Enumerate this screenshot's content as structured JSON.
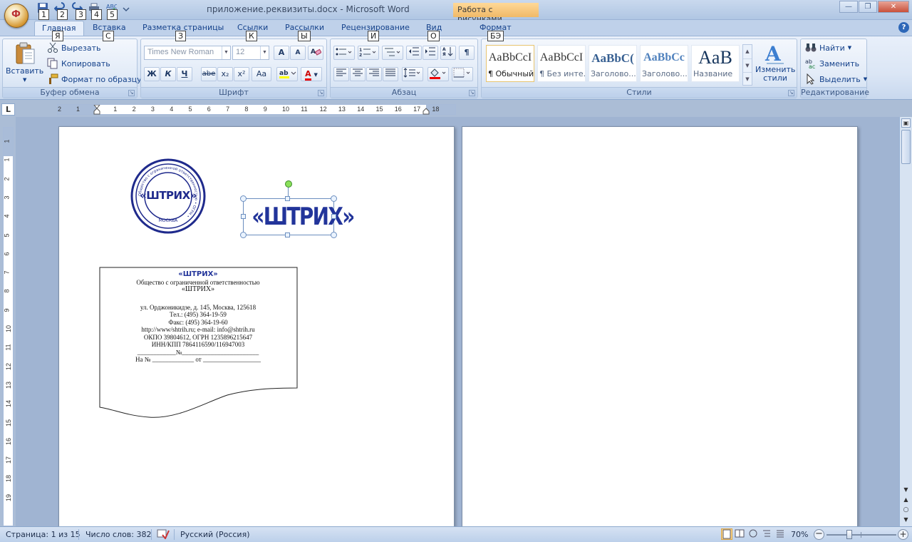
{
  "window": {
    "title": "приложение.реквизиты.docx - Microsoft Word",
    "context_tab": "Работа с рисунками",
    "office_button_glyph": "Ф"
  },
  "qat": {
    "keytips": [
      "1",
      "2",
      "3",
      "4",
      "5"
    ]
  },
  "tabs": [
    {
      "label": "Главная",
      "keytip": "Я"
    },
    {
      "label": "Вставка",
      "keytip": "С"
    },
    {
      "label": "Разметка страницы",
      "keytip": "З"
    },
    {
      "label": "Ссылки",
      "keytip": "К"
    },
    {
      "label": "Рассылки",
      "keytip": "Ы"
    },
    {
      "label": "Рецензирование",
      "keytip": "И"
    },
    {
      "label": "Вид",
      "keytip": "О"
    },
    {
      "label": "Формат",
      "keytip": "БЭ"
    }
  ],
  "help_glyph": "?",
  "clipboard": {
    "label": "Буфер обмена",
    "paste": "Вставить",
    "cut": "Вырезать",
    "copy": "Копировать",
    "format_painter": "Формат по образцу"
  },
  "font": {
    "label": "Шрифт",
    "family": "Times New Roman",
    "size": "12",
    "bold": "Ж",
    "italic": "К",
    "underline": "Ч",
    "strike": "abe",
    "subscript": "x₂",
    "superscript": "x²",
    "change_case": "Aa",
    "grow": "A",
    "shrink": "A",
    "font_color": "A"
  },
  "paragraph": {
    "label": "Абзац",
    "show_marks": "¶"
  },
  "styles": {
    "label": "Стили",
    "items": [
      {
        "preview": "AaBbCcI",
        "name": "¶ Обычный"
      },
      {
        "preview": "AaBbCcI",
        "name": "¶ Без инте..."
      },
      {
        "preview": "AaBbC(",
        "name": "Заголово..."
      },
      {
        "preview": "AaBbCc",
        "name": "Заголово..."
      },
      {
        "preview": "AaB",
        "name": "Название"
      }
    ],
    "change_styles": "Изменить стили"
  },
  "editing": {
    "label": "Редактирование",
    "find": "Найти",
    "replace": "Заменить",
    "select": "Выделить"
  },
  "ruler": {
    "corner_glyph": "L",
    "h_numbers": [
      "2",
      "1",
      "1",
      "2",
      "3",
      "4",
      "5",
      "6",
      "7",
      "8",
      "9",
      "10",
      "11",
      "12",
      "13",
      "14",
      "15",
      "16",
      "17",
      "18"
    ],
    "v_numbers": [
      "1",
      "1",
      "2",
      "3",
      "4",
      "5",
      "6",
      "7",
      "8",
      "9",
      "10",
      "11",
      "12",
      "13",
      "14",
      "15",
      "16",
      "17",
      "18",
      "19"
    ]
  },
  "document": {
    "stamp_center_text": "«ШТРИХ»",
    "stamp_ring_text": "Общество с ограниченной ответственностью • ОГРН •",
    "stamp_bottom_text": "МОСКВА",
    "logo_text": "«ШТРИХ»",
    "blank": {
      "logo": "«ШТРИХ»",
      "line1": "Общество с ограниченной ответственностью",
      "line2": "«ШТРИХ»",
      "line3": "ул. Орджоникидзе, д. 145, Москва, 125618",
      "line4": "Тел.: (495) 364-19-59",
      "line5": "Факс: (495) 364-19-60",
      "line6": "http://www/shtrih.ru; e-mail: info@shtrih.ru",
      "line7": "ОКПО 39804612, ОГРН 1235896215647",
      "line8": "ИНН/КПП 7864116590/116947003",
      "line9": "____________№________________________",
      "line10": "На № _____________ от __________________"
    }
  },
  "status": {
    "page": "Страница: 1 из 15",
    "words": "Число слов: 382",
    "language": "Русский (Россия)",
    "zoom": "70%",
    "zoom_level": 0.7
  }
}
